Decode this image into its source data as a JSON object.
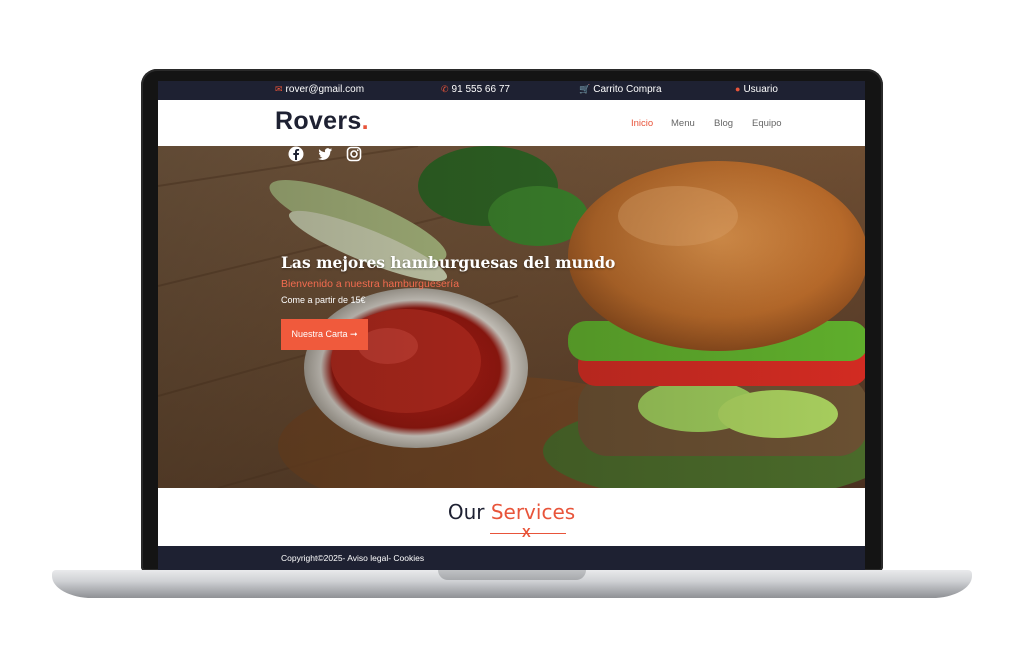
{
  "topbar": {
    "email": "rover@gmail.com",
    "phone": "91 555 66 77",
    "cart": "Carrito Compra",
    "user": "Usuario",
    "icons": [
      "envelope-icon",
      "phone-icon",
      "cart-icon",
      "user-icon"
    ]
  },
  "nav": {
    "logo_text": "Rovers",
    "logo_dot": ".",
    "items": [
      {
        "label": "Inicio",
        "active": true
      },
      {
        "label": "Menu",
        "active": false
      },
      {
        "label": "Blog",
        "active": false
      },
      {
        "label": "Equipo",
        "active": false
      }
    ]
  },
  "hero": {
    "title": "Las mejores hamburguesas del mundo",
    "subtitle": "Bienvenido a nuestra hamburguesería",
    "price_text": "Come a partir de 15€",
    "button_label": "Nuestra Carta ➞",
    "social": [
      "facebook-icon",
      "twitter-icon",
      "instagram-icon"
    ]
  },
  "services": {
    "title_main": "Our ",
    "title_accent": "Services",
    "divider_mark": "X"
  },
  "footer": {
    "text": "Copyright©2025- Aviso legal- Cookies"
  },
  "colors": {
    "accent": "#e8543a",
    "dark": "#1e2132"
  }
}
